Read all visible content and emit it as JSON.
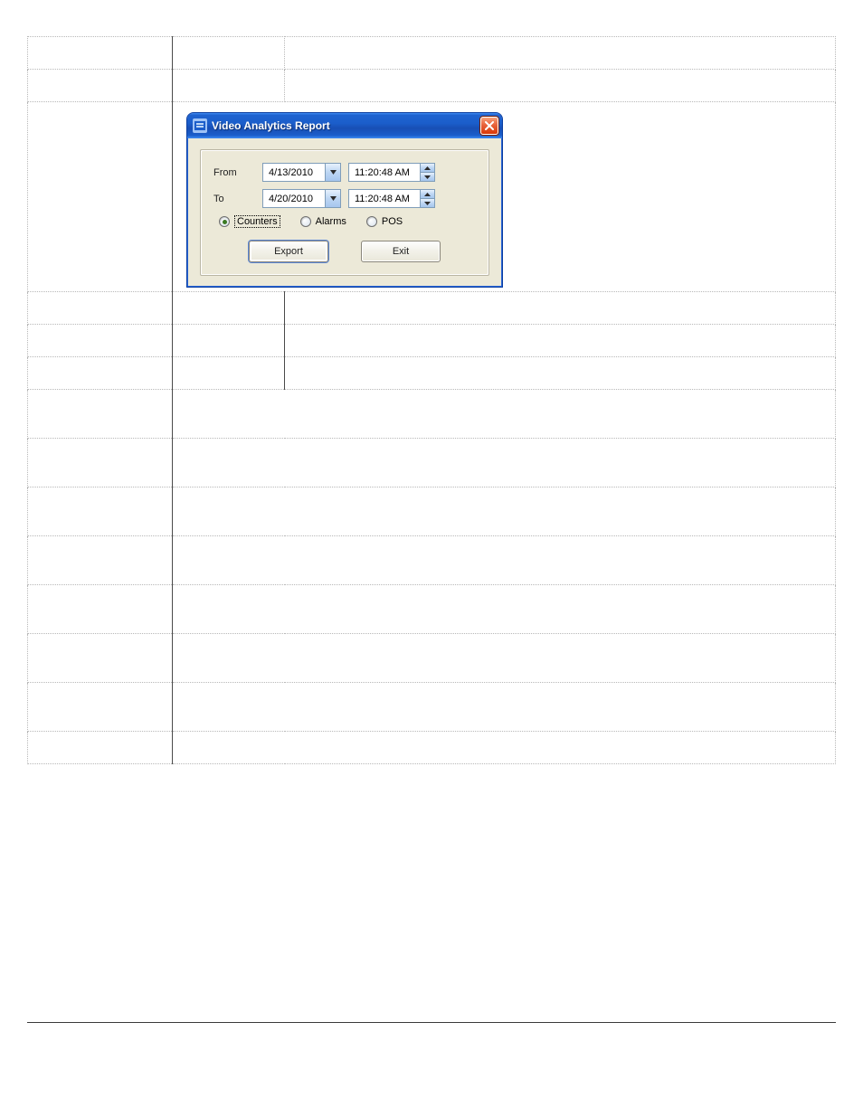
{
  "dialog": {
    "title": "Video Analytics Report",
    "from_label": "From",
    "to_label": "To",
    "from_date": "4/13/2010",
    "to_date": "4/20/2010",
    "from_time": "11:20:48 AM",
    "to_time": "11:20:48 AM",
    "radios": {
      "counters": "Counters",
      "alarms": "Alarms",
      "pos": "POS",
      "selected": "counters"
    },
    "buttons": {
      "export": "Export",
      "exit": "Exit"
    }
  }
}
